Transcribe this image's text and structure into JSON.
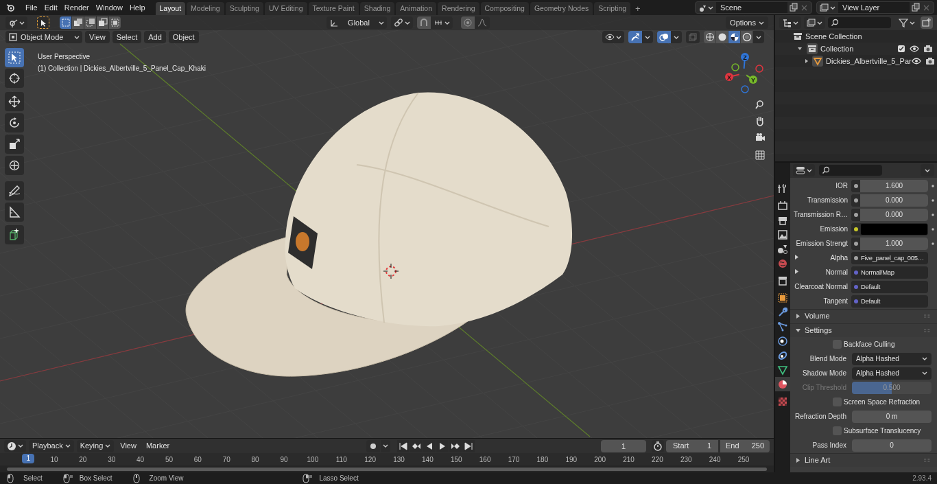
{
  "menu": [
    "File",
    "Edit",
    "Render",
    "Window",
    "Help"
  ],
  "workspace_tabs": [
    {
      "label": "Layout",
      "selected": true
    },
    {
      "label": "Modeling",
      "selected": false
    },
    {
      "label": "Sculpting",
      "selected": false
    },
    {
      "label": "UV Editing",
      "selected": false
    },
    {
      "label": "Texture Paint",
      "selected": false
    },
    {
      "label": "Shading",
      "selected": false
    },
    {
      "label": "Animation",
      "selected": false
    },
    {
      "label": "Rendering",
      "selected": false
    },
    {
      "label": "Compositing",
      "selected": false
    },
    {
      "label": "Geometry Nodes",
      "selected": false
    },
    {
      "label": "Scripting",
      "selected": false
    }
  ],
  "add_tab": "+",
  "scene": "Scene",
  "view_layer": "View Layer",
  "selection_modes": [
    {
      "selected": true
    },
    {
      "selected": false
    },
    {
      "selected": false
    },
    {
      "selected": false
    },
    {
      "selected": false
    }
  ],
  "shading_modes": [
    {
      "selected": false
    },
    {
      "selected": false
    },
    {
      "selected": true
    },
    {
      "selected": false
    }
  ],
  "toolbar": [
    {
      "selected": true
    },
    {
      "selected": false
    },
    {
      "selected": false
    },
    {
      "selected": false
    },
    {
      "selected": false
    },
    {
      "selected": false
    },
    {
      "selected": false
    },
    {
      "selected": false
    },
    {
      "selected": false
    }
  ],
  "tool_header": {
    "orientation": "Global",
    "options": "Options"
  },
  "viewport_header": {
    "mode": "Object Mode",
    "menus": [
      "View",
      "Select",
      "Add",
      "Object"
    ]
  },
  "viewport": {
    "perspective": "User Perspective",
    "object_info": "(1) Collection | Dickies_Albertville_5_Panel_Cap_Khaki",
    "gizmo": [
      {
        "label": "Z",
        "color": "#2f75d8"
      },
      {
        "label": "X",
        "color": "#e0353f"
      },
      {
        "label": "Y",
        "color": "#76b82a"
      }
    ]
  },
  "outliner": {
    "items": [
      {
        "label": "Scene Collection",
        "children": [
          {
            "label": "Collection",
            "expanded": true,
            "children": [
              {
                "label": "Dickies_Albertville_5_Par",
                "expanded": false
              }
            ]
          }
        ]
      }
    ]
  },
  "properties": {
    "tabs": [
      {
        "selected": false
      },
      {
        "selected": false
      },
      {
        "selected": false
      },
      {
        "selected": false
      },
      {
        "selected": false
      },
      {
        "selected": false
      },
      {
        "selected": false
      },
      {
        "selected": false
      },
      {
        "selected": false
      },
      {
        "selected": false
      },
      {
        "selected": false
      },
      {
        "selected": false
      },
      {
        "selected": false
      },
      {
        "selected": true
      },
      {
        "selected": false
      }
    ],
    "rows": [
      {
        "kind": "number",
        "label": "IOR",
        "value": "1.600",
        "color": "#a1a1a1"
      },
      {
        "kind": "number",
        "label": "Transmission",
        "value": "0.000",
        "color": "#a1a1a1"
      },
      {
        "kind": "number",
        "label": "Transmission R…",
        "value": "0.000",
        "color": "#a1a1a1"
      },
      {
        "kind": "color",
        "label": "Emission",
        "color": "#c7c729"
      },
      {
        "kind": "number",
        "label": "Emission Strengt",
        "value": "1.000",
        "color": "#a1a1a1"
      },
      {
        "kind": "link",
        "label": "Alpha",
        "value": "Five_panel_cap_005…",
        "color": "#a1a1a1",
        "expanded": false
      },
      {
        "kind": "link",
        "label": "Normal",
        "value": "Normal/Map",
        "color": "#6363c7",
        "expanded": false
      },
      {
        "kind": "link",
        "label": "Clearcoat Normal",
        "value": "Default",
        "color": "#6363c7"
      },
      {
        "kind": "link",
        "label": "Tangent",
        "value": "Default",
        "color": "#6363c7"
      },
      {
        "kind": "section",
        "label": "Volume",
        "expanded": false
      },
      {
        "kind": "section",
        "label": "Settings",
        "expanded": true
      },
      {
        "kind": "checkbox",
        "label": "Backface Culling",
        "checked": false
      },
      {
        "kind": "dropdown",
        "label": "Blend Mode",
        "value": "Alpha Hashed"
      },
      {
        "kind": "dropdown",
        "label": "Shadow Mode",
        "value": "Alpha Hashed"
      },
      {
        "kind": "slider",
        "label": "Clip Threshold",
        "value": "0.500",
        "level": 0.5,
        "disabled": true
      },
      {
        "kind": "checkbox",
        "label": "Screen Space Refraction",
        "checked": false
      },
      {
        "kind": "field",
        "label": "Refraction Depth",
        "value": "0 m"
      },
      {
        "kind": "checkbox",
        "label": "Subsurface Translucency",
        "checked": false
      },
      {
        "kind": "field",
        "label": "Pass Index",
        "value": "0"
      },
      {
        "kind": "section",
        "label": "Line Art",
        "expanded": false
      }
    ]
  },
  "timeline": {
    "menus": [
      "Playback",
      "Keying",
      "View",
      "Marker"
    ],
    "current_frame": "1",
    "start_label": "Start",
    "start": "1",
    "end_label": "End",
    "end": "250",
    "playhead": "1",
    "ticks": [
      "10",
      "20",
      "30",
      "40",
      "50",
      "60",
      "70",
      "80",
      "90",
      "100",
      "110",
      "120",
      "130",
      "140",
      "150",
      "160",
      "170",
      "180",
      "190",
      "200",
      "210",
      "220",
      "230",
      "240",
      "250"
    ]
  },
  "status_bar": {
    "hints": [
      "Select",
      "Box Select",
      "Zoom View",
      "Lasso Select"
    ],
    "version": "2.93.4"
  }
}
